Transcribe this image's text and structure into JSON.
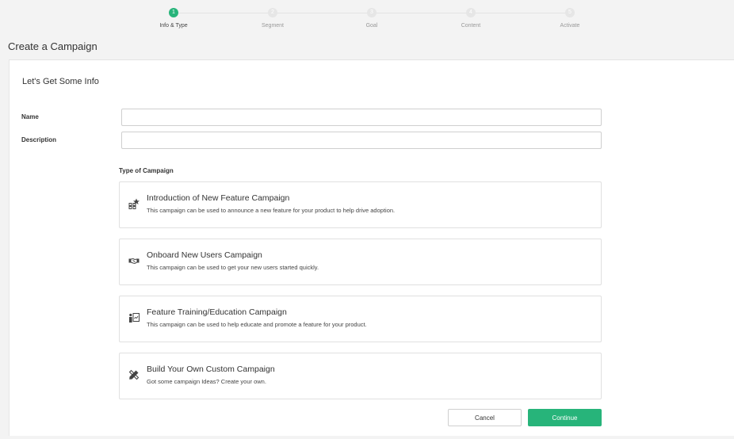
{
  "stepper": {
    "steps": [
      {
        "number": "1",
        "label": "Info & Type"
      },
      {
        "number": "2",
        "label": "Segment"
      },
      {
        "number": "3",
        "label": "Goal"
      },
      {
        "number": "4",
        "label": "Content"
      },
      {
        "number": "5",
        "label": "Activate"
      }
    ],
    "active_step": 1
  },
  "page": {
    "title": "Create a Campaign"
  },
  "form": {
    "section_title": "Let's Get Some Info",
    "name_label": "Name",
    "name_value": "",
    "description_label": "Description",
    "description_value": "",
    "type_heading": "Type of Campaign",
    "options": [
      {
        "icon": "feature-grid-star-icon",
        "title": "Introduction of New Feature Campaign",
        "description": "This campaign can be used to announce a new feature for your product to help drive adoption."
      },
      {
        "icon": "handshake-icon",
        "title": "Onboard New Users Campaign",
        "description": "This campaign can be used to get your new users started quickly."
      },
      {
        "icon": "presentation-icon",
        "title": "Feature Training/Education Campaign",
        "description": "This campaign can be used to help educate and promote a feature for your product."
      },
      {
        "icon": "pencil-ruler-icon",
        "title": "Build Your Own Custom Campaign",
        "description": "Got some campaign Ideas? Create your own."
      }
    ]
  },
  "actions": {
    "cancel_label": "Cancel",
    "continue_label": "Continue"
  },
  "colors": {
    "accent": "#27b47a",
    "step_inactive": "#e6e6e6",
    "border": "#e0e0e0"
  }
}
